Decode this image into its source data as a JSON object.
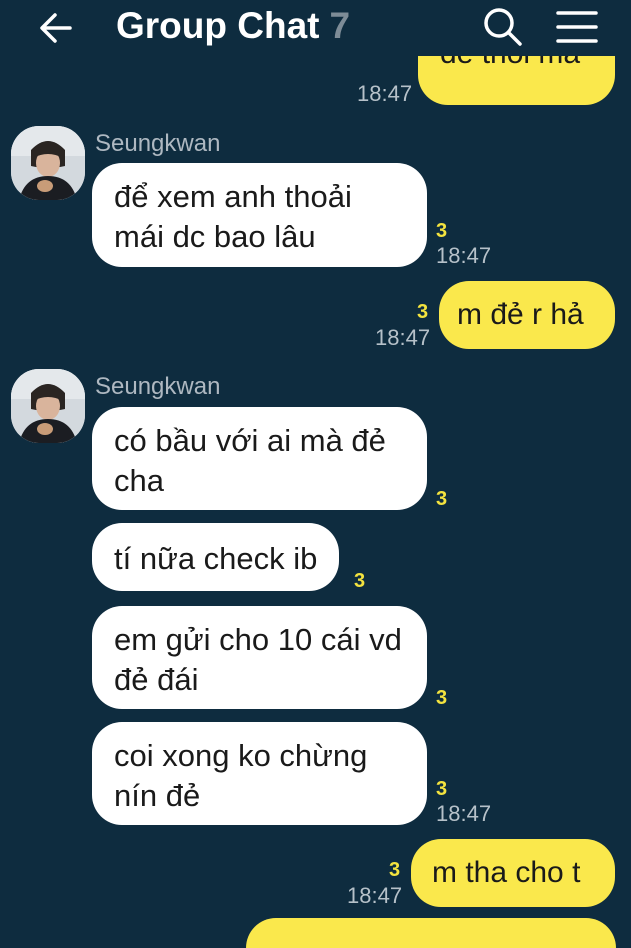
{
  "header": {
    "title": "Group Chat",
    "member_count": "7"
  },
  "messages": {
    "m0": {
      "text": "đề thôi mà",
      "time": "18:47"
    },
    "g1": {
      "sender": "Seungkwan",
      "b1": {
        "text": "để xem anh thoải mái dc bao lâu",
        "unread": "3",
        "time": "18:47"
      }
    },
    "m1": {
      "text": "m đẻ r hả",
      "unread": "3",
      "time": "18:47"
    },
    "g2": {
      "sender": "Seungkwan",
      "b1": {
        "text": "có bầu với ai mà đẻ cha",
        "unread": "3"
      },
      "b2": {
        "text": "tí nữa check ib",
        "unread": "3"
      },
      "b3": {
        "text": "em gửi cho 10 cái vd đẻ đái",
        "unread": "3"
      },
      "b4": {
        "text": "coi xong ko chừng nín đẻ",
        "unread": "3",
        "time": "18:47"
      }
    },
    "m2": {
      "text": "m tha cho t",
      "unread": "3",
      "time": "18:47"
    }
  },
  "colors": {
    "background": "#0e2c3f",
    "my_bubble": "#fae84c",
    "other_bubble": "#ffffff",
    "unread": "#f3e33f"
  }
}
